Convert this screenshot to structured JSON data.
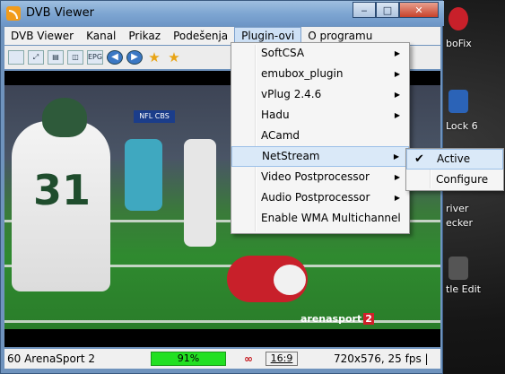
{
  "window": {
    "title": "DVB Viewer"
  },
  "desktop": {
    "items": [
      "boFix",
      "Lock 6",
      "river",
      "ecker",
      "tle Edit"
    ]
  },
  "menubar": {
    "items": [
      "DVB Viewer",
      "Kanal",
      "Prikaz",
      "Podešenja",
      "Plugin-ovi",
      "O programu"
    ]
  },
  "plugin_menu": {
    "items": [
      {
        "label": "SoftCSA",
        "submenu": true
      },
      {
        "label": "emubox_plugin",
        "submenu": true
      },
      {
        "label": "vPlug 2.4.6",
        "submenu": true
      },
      {
        "label": "Hadu",
        "submenu": true
      },
      {
        "label": "ACamd",
        "submenu": false
      },
      {
        "label": "NetStream",
        "submenu": true
      },
      {
        "label": "Video Postprocessor",
        "submenu": true
      },
      {
        "label": "Audio Postprocessor",
        "submenu": true
      },
      {
        "label": "Enable WMA Multichannel",
        "submenu": false
      }
    ]
  },
  "netstream_submenu": {
    "items": [
      {
        "label": "Active",
        "checked": true
      },
      {
        "label": "Configure",
        "checked": false
      }
    ]
  },
  "video": {
    "overlay_logo": "NFL CBS",
    "watermark": "arenasport",
    "watermark_num": "2",
    "jersey_number": "31"
  },
  "statusbar": {
    "channel": "60 ArenaSport 2",
    "signal_percent": "91%",
    "aspect": "16:9",
    "resolution": "720x576, 25 fps |"
  },
  "colors": {
    "signal": "#22e022",
    "menu_highlight": "#dae9f8"
  }
}
